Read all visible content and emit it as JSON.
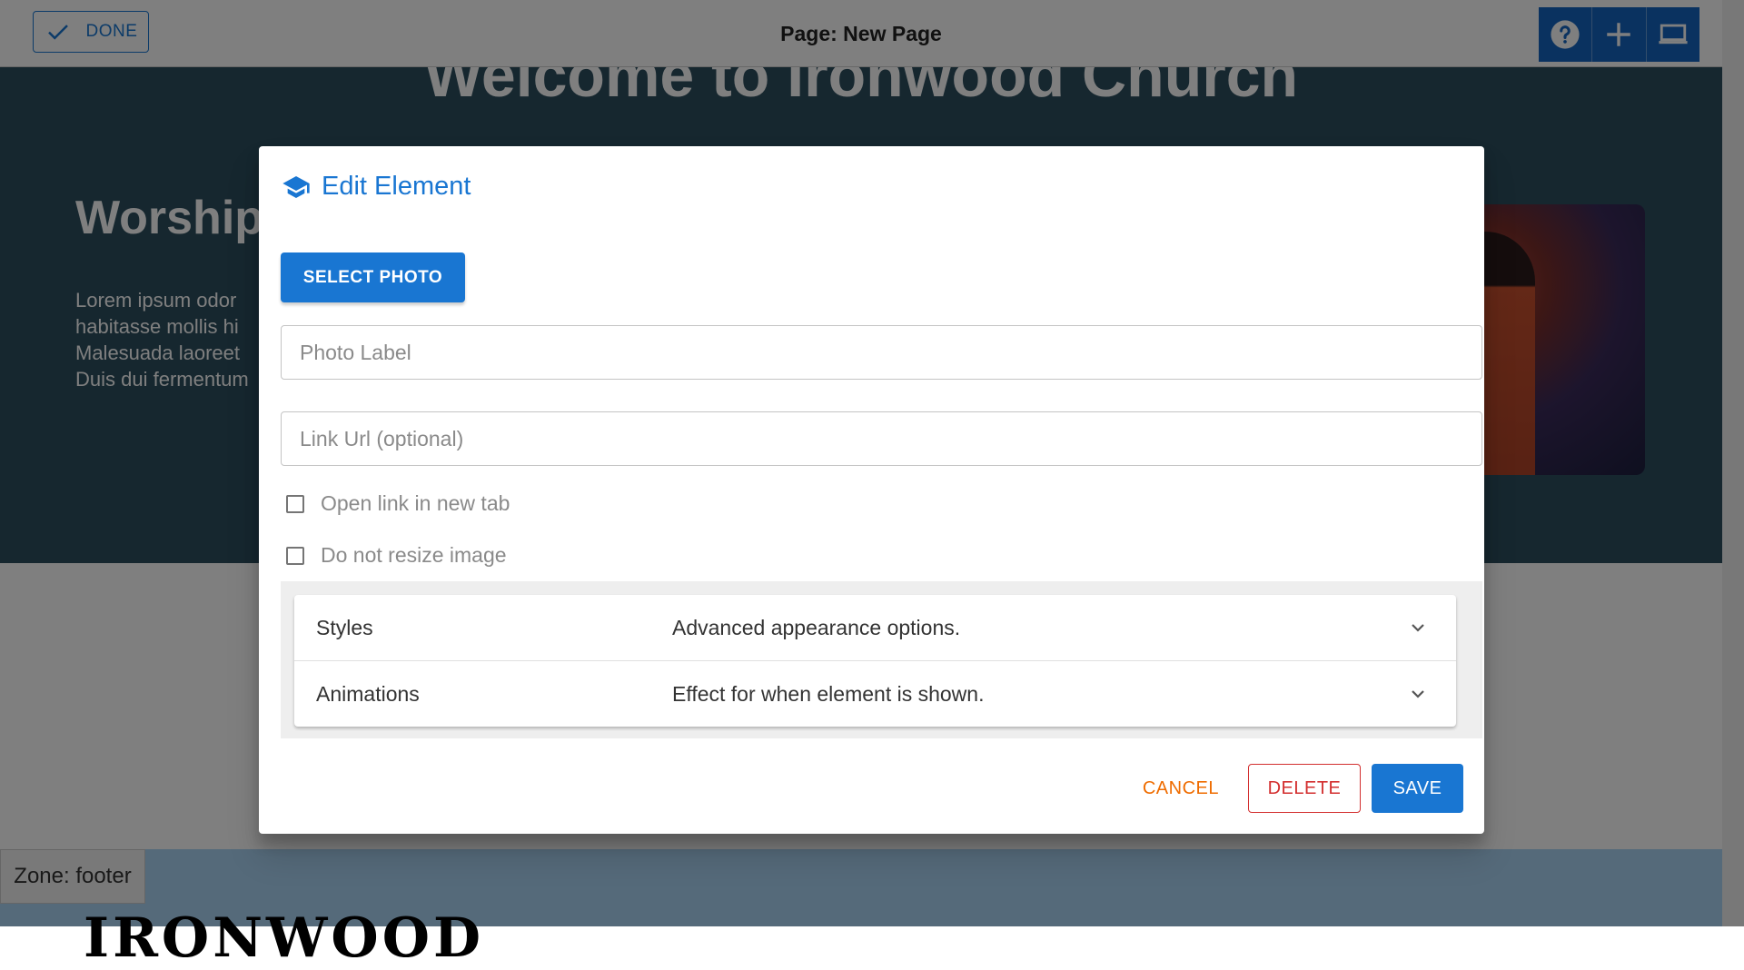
{
  "topbar": {
    "done_label": "DONE",
    "page_title": "Page: New Page",
    "tools": [
      "help-icon",
      "add-icon",
      "desktop-icon"
    ]
  },
  "background_page": {
    "hero_heading": "Welcome to Ironwood Church",
    "hero_subheading": "Worship",
    "hero_body_lines": [
      "Lorem ipsum odor",
      "habitasse mollis hi",
      "Malesuada laoreet",
      "Duis dui fermentum"
    ],
    "zone_label": "Zone: footer",
    "footer_logo": "IRONWOOD"
  },
  "dialog": {
    "title": "Edit Element",
    "title_icon": "graduation-cap-icon",
    "select_photo_label": "SELECT PHOTO",
    "photo_label_placeholder": "Photo Label",
    "photo_label_value": "",
    "link_url_placeholder": "Link Url (optional)",
    "link_url_value": "",
    "checkboxes": [
      {
        "label": "Open link in new tab",
        "checked": false
      },
      {
        "label": "Do not resize image",
        "checked": false
      }
    ],
    "panels": [
      {
        "name": "Styles",
        "description": "Advanced appearance options."
      },
      {
        "name": "Animations",
        "description": "Effect for when element is shown."
      }
    ],
    "actions": {
      "cancel": "CANCEL",
      "delete": "DELETE",
      "save": "SAVE"
    }
  },
  "colors": {
    "primary": "#1976d2",
    "cancel": "#ef6c00",
    "delete": "#d32f2f",
    "hero_bg": "#2c4e5f"
  }
}
